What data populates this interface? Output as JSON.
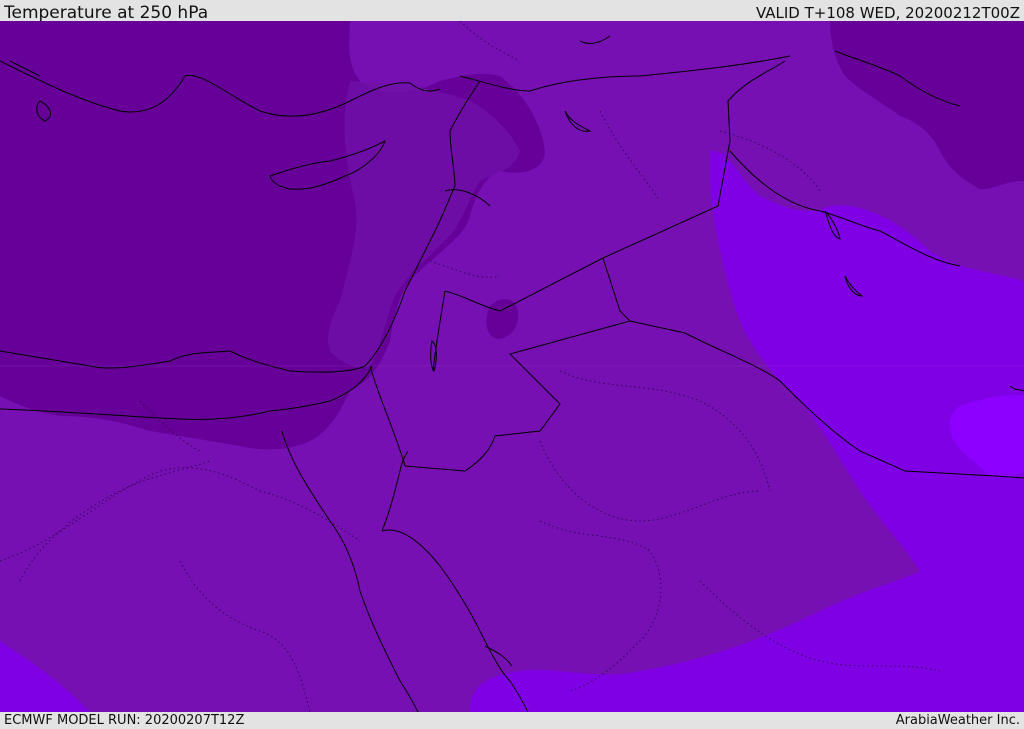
{
  "header": {
    "title": "Temperature at 250 hPa",
    "valid_time": "VALID T+108 WED, 20200212T00Z"
  },
  "footer": {
    "model_run": "ECMWF MODEL RUN: 20200207T12Z",
    "credit": "ArabiaWeather Inc."
  },
  "colors": {
    "coldest": "#660099",
    "cold": "#7710b3",
    "mild": "#7e06d6",
    "warm": "#8000e6",
    "warmest": "#8c00ff",
    "coastline": "#000000"
  }
}
